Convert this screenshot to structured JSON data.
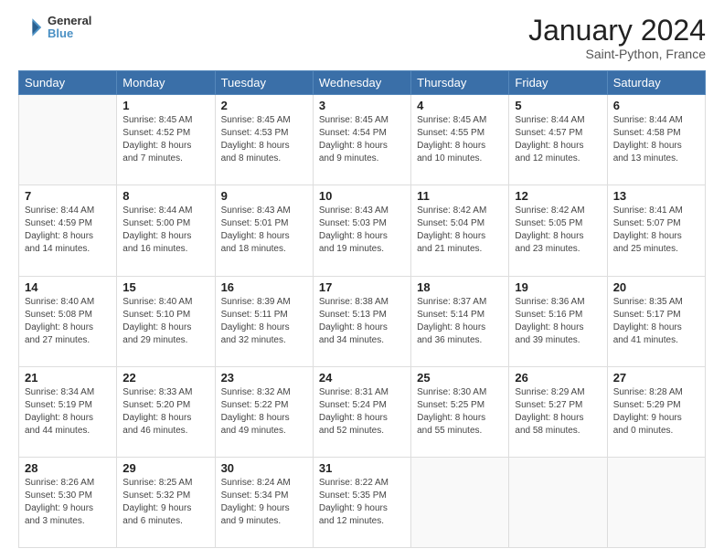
{
  "header": {
    "logo_line1": "General",
    "logo_line2": "Blue",
    "month": "January 2024",
    "location": "Saint-Python, France"
  },
  "weekdays": [
    "Sunday",
    "Monday",
    "Tuesday",
    "Wednesday",
    "Thursday",
    "Friday",
    "Saturday"
  ],
  "weeks": [
    [
      {
        "day": "",
        "info": ""
      },
      {
        "day": "1",
        "info": "Sunrise: 8:45 AM\nSunset: 4:52 PM\nDaylight: 8 hours\nand 7 minutes."
      },
      {
        "day": "2",
        "info": "Sunrise: 8:45 AM\nSunset: 4:53 PM\nDaylight: 8 hours\nand 8 minutes."
      },
      {
        "day": "3",
        "info": "Sunrise: 8:45 AM\nSunset: 4:54 PM\nDaylight: 8 hours\nand 9 minutes."
      },
      {
        "day": "4",
        "info": "Sunrise: 8:45 AM\nSunset: 4:55 PM\nDaylight: 8 hours\nand 10 minutes."
      },
      {
        "day": "5",
        "info": "Sunrise: 8:44 AM\nSunset: 4:57 PM\nDaylight: 8 hours\nand 12 minutes."
      },
      {
        "day": "6",
        "info": "Sunrise: 8:44 AM\nSunset: 4:58 PM\nDaylight: 8 hours\nand 13 minutes."
      }
    ],
    [
      {
        "day": "7",
        "info": "Sunrise: 8:44 AM\nSunset: 4:59 PM\nDaylight: 8 hours\nand 14 minutes."
      },
      {
        "day": "8",
        "info": "Sunrise: 8:44 AM\nSunset: 5:00 PM\nDaylight: 8 hours\nand 16 minutes."
      },
      {
        "day": "9",
        "info": "Sunrise: 8:43 AM\nSunset: 5:01 PM\nDaylight: 8 hours\nand 18 minutes."
      },
      {
        "day": "10",
        "info": "Sunrise: 8:43 AM\nSunset: 5:03 PM\nDaylight: 8 hours\nand 19 minutes."
      },
      {
        "day": "11",
        "info": "Sunrise: 8:42 AM\nSunset: 5:04 PM\nDaylight: 8 hours\nand 21 minutes."
      },
      {
        "day": "12",
        "info": "Sunrise: 8:42 AM\nSunset: 5:05 PM\nDaylight: 8 hours\nand 23 minutes."
      },
      {
        "day": "13",
        "info": "Sunrise: 8:41 AM\nSunset: 5:07 PM\nDaylight: 8 hours\nand 25 minutes."
      }
    ],
    [
      {
        "day": "14",
        "info": "Sunrise: 8:40 AM\nSunset: 5:08 PM\nDaylight: 8 hours\nand 27 minutes."
      },
      {
        "day": "15",
        "info": "Sunrise: 8:40 AM\nSunset: 5:10 PM\nDaylight: 8 hours\nand 29 minutes."
      },
      {
        "day": "16",
        "info": "Sunrise: 8:39 AM\nSunset: 5:11 PM\nDaylight: 8 hours\nand 32 minutes."
      },
      {
        "day": "17",
        "info": "Sunrise: 8:38 AM\nSunset: 5:13 PM\nDaylight: 8 hours\nand 34 minutes."
      },
      {
        "day": "18",
        "info": "Sunrise: 8:37 AM\nSunset: 5:14 PM\nDaylight: 8 hours\nand 36 minutes."
      },
      {
        "day": "19",
        "info": "Sunrise: 8:36 AM\nSunset: 5:16 PM\nDaylight: 8 hours\nand 39 minutes."
      },
      {
        "day": "20",
        "info": "Sunrise: 8:35 AM\nSunset: 5:17 PM\nDaylight: 8 hours\nand 41 minutes."
      }
    ],
    [
      {
        "day": "21",
        "info": "Sunrise: 8:34 AM\nSunset: 5:19 PM\nDaylight: 8 hours\nand 44 minutes."
      },
      {
        "day": "22",
        "info": "Sunrise: 8:33 AM\nSunset: 5:20 PM\nDaylight: 8 hours\nand 46 minutes."
      },
      {
        "day": "23",
        "info": "Sunrise: 8:32 AM\nSunset: 5:22 PM\nDaylight: 8 hours\nand 49 minutes."
      },
      {
        "day": "24",
        "info": "Sunrise: 8:31 AM\nSunset: 5:24 PM\nDaylight: 8 hours\nand 52 minutes."
      },
      {
        "day": "25",
        "info": "Sunrise: 8:30 AM\nSunset: 5:25 PM\nDaylight: 8 hours\nand 55 minutes."
      },
      {
        "day": "26",
        "info": "Sunrise: 8:29 AM\nSunset: 5:27 PM\nDaylight: 8 hours\nand 58 minutes."
      },
      {
        "day": "27",
        "info": "Sunrise: 8:28 AM\nSunset: 5:29 PM\nDaylight: 9 hours\nand 0 minutes."
      }
    ],
    [
      {
        "day": "28",
        "info": "Sunrise: 8:26 AM\nSunset: 5:30 PM\nDaylight: 9 hours\nand 3 minutes."
      },
      {
        "day": "29",
        "info": "Sunrise: 8:25 AM\nSunset: 5:32 PM\nDaylight: 9 hours\nand 6 minutes."
      },
      {
        "day": "30",
        "info": "Sunrise: 8:24 AM\nSunset: 5:34 PM\nDaylight: 9 hours\nand 9 minutes."
      },
      {
        "day": "31",
        "info": "Sunrise: 8:22 AM\nSunset: 5:35 PM\nDaylight: 9 hours\nand 12 minutes."
      },
      {
        "day": "",
        "info": ""
      },
      {
        "day": "",
        "info": ""
      },
      {
        "day": "",
        "info": ""
      }
    ]
  ]
}
